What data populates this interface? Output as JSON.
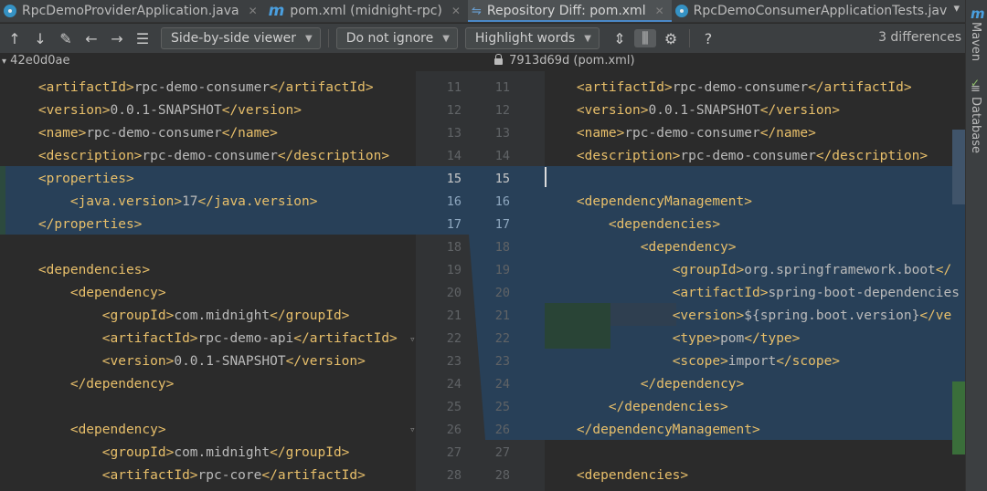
{
  "tabs": [
    {
      "label": "RpcDemoProviderApplication.java",
      "icon": "java-class-icon",
      "closable": true,
      "active": false
    },
    {
      "label": "pom.xml (midnight-rpc)",
      "icon": "maven-icon",
      "closable": true,
      "active": false
    },
    {
      "label": "Repository Diff: pom.xml",
      "icon": "diff-icon",
      "closable": true,
      "active": true
    },
    {
      "label": "RpcDemoConsumerApplicationTests.jav",
      "icon": "java-class-icon",
      "closable": false,
      "active": false
    }
  ],
  "toolbar": {
    "viewer_mode": "Side-by-side viewer",
    "whitespace": "Do not ignore",
    "highlight": "Highlight words",
    "help": "?",
    "differences": "3 differences"
  },
  "revisions": {
    "left": "42e0d0ae",
    "right": "7913d69d (pom.xml)"
  },
  "tool_windows": {
    "maven": "Maven",
    "database": "Database"
  },
  "left_lines": [
    "    <artifactId>rpc-demo-consumer</artifactId>",
    "    <version>0.0.1-SNAPSHOT</version>",
    "    <name>rpc-demo-consumer</name>",
    "    <description>rpc-demo-consumer</description>",
    "    <properties>",
    "        <java.version>17</java.version>",
    "    </properties>",
    "",
    "    <dependencies>",
    "        <dependency>",
    "            <groupId>com.midnight</groupId>",
    "            <artifactId>rpc-demo-api</artifactId>",
    "            <version>0.0.1-SNAPSHOT</version>",
    "        </dependency>",
    "",
    "        <dependency>",
    "            <groupId>com.midnight</groupId>",
    "            <artifactId>rpc-core</artifactId>"
  ],
  "right_lines": [
    "    <artifactId>rpc-demo-consumer</artifactId>",
    "    <version>0.0.1-SNAPSHOT</version>",
    "    <name>rpc-demo-consumer</name>",
    "    <description>rpc-demo-consumer</description>",
    "",
    "    <dependencyManagement>",
    "        <dependencies>",
    "            <dependency>",
    "                <groupId>org.springframework.boot</",
    "                <artifactId>spring-boot-dependencies",
    "                <version>${spring.boot.version}</ve",
    "                <type>pom</type>",
    "                <scope>import</scope>",
    "            </dependency>",
    "        </dependencies>",
    "    </dependencyManagement>",
    "",
    "    <dependencies>"
  ],
  "left_numbers": [
    "11",
    "12",
    "13",
    "14",
    "15",
    "16",
    "17",
    "18",
    "19",
    "20",
    "21",
    "22",
    "23",
    "24",
    "25",
    "26",
    "27",
    "28"
  ],
  "right_numbers": [
    "11",
    "12",
    "13",
    "14",
    "15",
    "16",
    "17",
    "18",
    "19",
    "20",
    "21",
    "22",
    "23",
    "24",
    "25",
    "26",
    "27",
    "28"
  ],
  "colors": {
    "changed_block": "#284058",
    "tag": "#e8bf6a",
    "accent": "#4a88c7"
  }
}
